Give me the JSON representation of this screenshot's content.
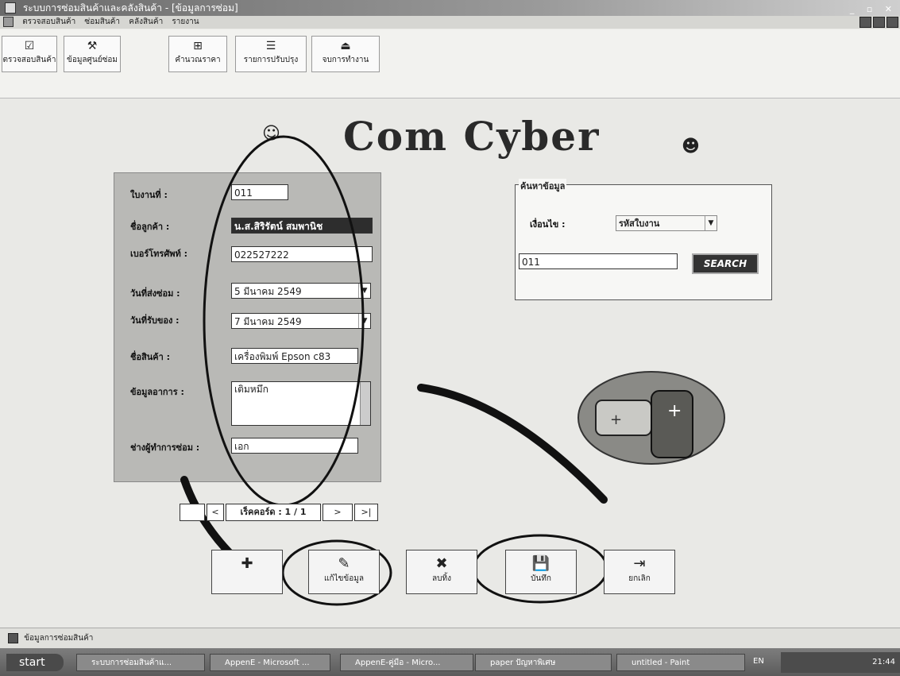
{
  "window": {
    "title": "ระบบการซ่อมสินค้าและคลังสินค้า - [ข้อมูลการซ่อม]"
  },
  "menubar": {
    "items": [
      "ตรวจสอบสินค้า",
      "ซ่อมสินค้า",
      "คลังสินค้า",
      "รายงาน"
    ]
  },
  "toolbar": {
    "buttons": [
      "ตรวจสอบสินค้า",
      "ข้อมูลศูนย์ซ่อม",
      "คำนวณราคา",
      "รายการปรับปรุง",
      "จบการทำงาน"
    ]
  },
  "logo": "Com Cyber",
  "form": {
    "job_no": {
      "label": "ใบงานที่ :",
      "value": "011"
    },
    "customer": {
      "label": "ชื่อลูกค้า :",
      "value": "น.ส.สิริรัตน์ สมพานิช"
    },
    "phone": {
      "label": "เบอร์โทรศัพท์ :",
      "value": "022527222"
    },
    "send_date": {
      "label": "วันที่ส่งซ่อม :",
      "value": "5   มีนาคม    2549"
    },
    "receive_date": {
      "label": "วันที่รับของ :",
      "value": "7   มีนาคม    2549"
    },
    "product": {
      "label": "ชื่อสินค้า :",
      "value": "เครื่องพิมพ์ Epson c83"
    },
    "symptom": {
      "label": "ข้อมูลอาการ :",
      "value": "เติมหมึก"
    },
    "technician": {
      "label": "ช่างผู้ทำการซ่อม :",
      "value": "เอก"
    }
  },
  "search": {
    "legend": "ค้นหาข้อมูล",
    "condition_label": "เงื่อนไข :",
    "condition_value": "รหัสใบงาน",
    "input_value": "011",
    "button": "SEARCH"
  },
  "nav": {
    "prev": "<",
    "record": "เร็คคอร์ด : 1 / 1",
    "next": ">",
    "last": ">|"
  },
  "actions": {
    "edit": "แก้ไขข้อมูล",
    "delete": "ลบทิ้ง",
    "save": "บันทึก",
    "cancel": "ยกเลิก"
  },
  "status": {
    "text": "ข้อมูลการซ่อมสินค้า"
  },
  "taskbar": {
    "start": "start",
    "tasks": [
      "ระบบการซ่อมสินค้าแ...",
      "AppenE - Microsoft ...",
      "AppenE-คู่มือ - Micro...",
      "paper ปัญหาพิเศษ",
      "untitled - Paint"
    ],
    "lang": "EN",
    "clock": "21:44"
  },
  "colors": {
    "panel": "#b9b9b6",
    "button_dark": "#333333"
  }
}
